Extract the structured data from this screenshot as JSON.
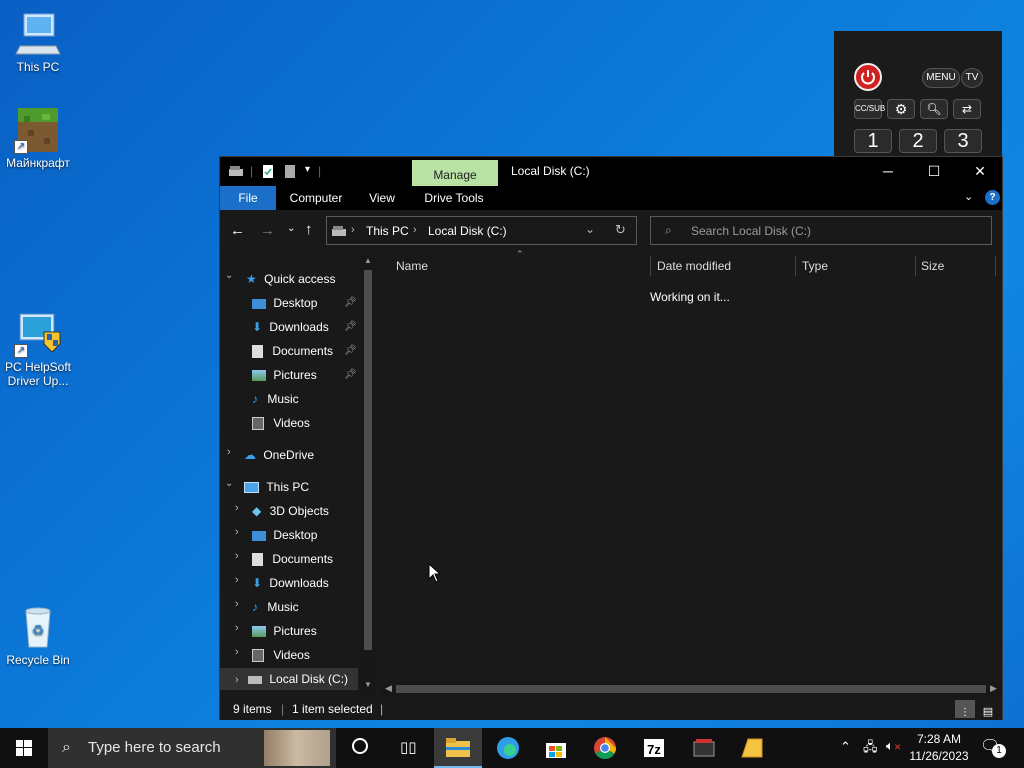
{
  "desktop": {
    "icons": [
      {
        "label": "This PC"
      },
      {
        "label": "Майнкрафт"
      },
      {
        "label": "PC HelpSoft Driver Up..."
      },
      {
        "label": "Recycle Bin"
      }
    ]
  },
  "remote": {
    "menu": "MENU",
    "tv": "TV",
    "ccsub": "CC/SUB",
    "num1": "1",
    "num2": "2",
    "num3": "3"
  },
  "window": {
    "title": "Local Disk (C:)",
    "context_tab": "Manage",
    "tabs": [
      "File",
      "Computer",
      "View",
      "Drive Tools"
    ],
    "breadcrumb": [
      "This PC",
      "Local Disk (C:)"
    ],
    "search_placeholder": "Search Local Disk (C:)",
    "nav": {
      "quick_access": "Quick access",
      "quick_items": [
        "Desktop",
        "Downloads",
        "Documents",
        "Pictures",
        "Music",
        "Videos"
      ],
      "onedrive": "OneDrive",
      "this_pc": "This PC",
      "pc_items": [
        "3D Objects",
        "Desktop",
        "Documents",
        "Downloads",
        "Music",
        "Pictures",
        "Videos",
        "Local Disk (C:)"
      ]
    },
    "columns": [
      "Name",
      "Date modified",
      "Type",
      "Size"
    ],
    "loading_text": "Working on it...",
    "status": {
      "items": "9 items",
      "selected": "1 item selected"
    }
  },
  "taskbar": {
    "search_placeholder": "Type here to search",
    "time": "7:28 AM",
    "date": "11/26/2023",
    "notification_count": "1"
  },
  "colors": {
    "desktop_blue": "#0b78d8",
    "manage_tab": "#b8e3a5",
    "file_tab": "#1b6fc8",
    "window_bg": "#191919"
  }
}
